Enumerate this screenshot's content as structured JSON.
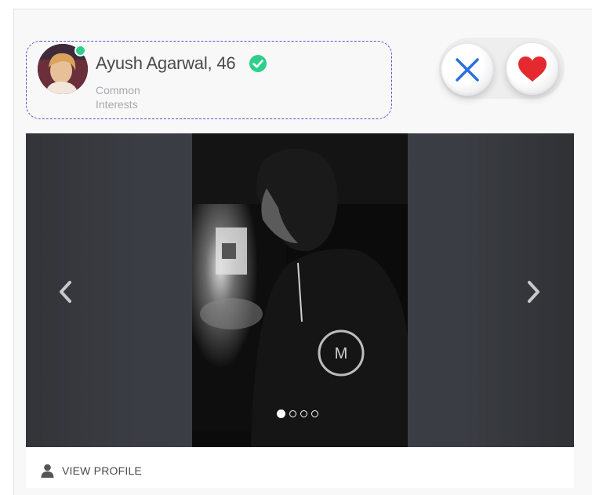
{
  "profile": {
    "name": "Ayush Agarwal, 46",
    "interests_line1": "Common",
    "interests_line2": "Interests",
    "online": true,
    "verified": true
  },
  "actions": {
    "reject_icon": "close-icon",
    "like_icon": "heart-icon"
  },
  "carousel": {
    "slide_count": 4,
    "active_index": 0
  },
  "footer": {
    "view_profile_label": "VIEW PROFILE",
    "icon": "user-icon"
  },
  "colors": {
    "online": "#2ecf8a",
    "verified": "#2ecf8a",
    "reject": "#2a6fe0",
    "like": "#e52a2f",
    "accent_border": "#5a4fcf"
  }
}
